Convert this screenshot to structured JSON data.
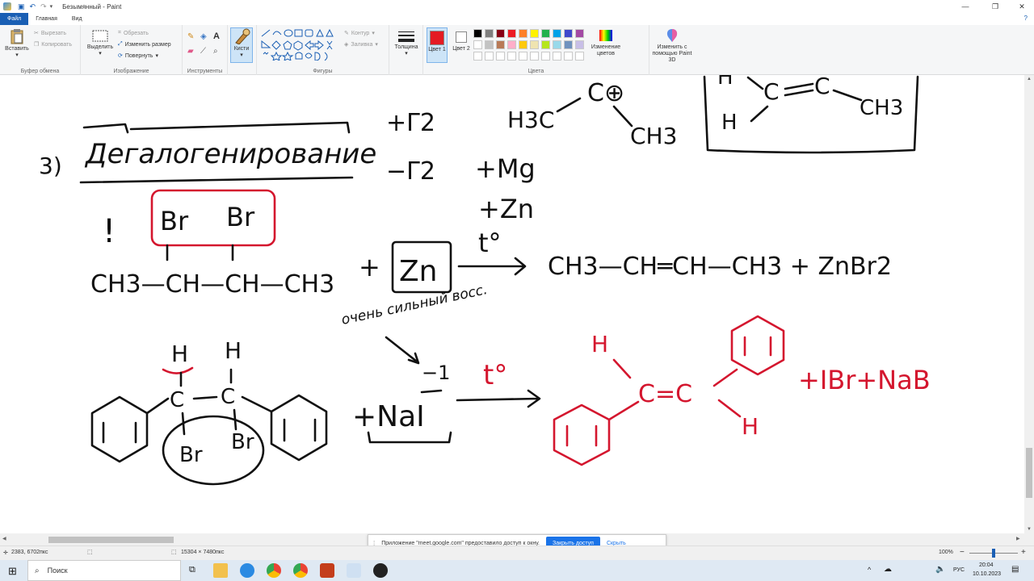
{
  "window": {
    "title": "Безымянный - Paint"
  },
  "tabs": [
    {
      "label": "Файл"
    },
    {
      "label": "Главная"
    },
    {
      "label": "Вид"
    }
  ],
  "ribbon": {
    "clipboard": {
      "label": "Буфер обмена",
      "paste": "Вставить",
      "cut": "Вырезать",
      "copy": "Копировать"
    },
    "image": {
      "label": "Изображение",
      "select": "Выделить",
      "crop": "Обрезать",
      "resize": "Изменить размер",
      "rotate": "Повернуть"
    },
    "tools": {
      "label": "Инструменты"
    },
    "brushes": {
      "label": "Кисти"
    },
    "shapes": {
      "label": "Фигуры",
      "outline": "Контур",
      "fill": "Заливка"
    },
    "size": {
      "label": "Толщина"
    },
    "colors": {
      "label": "Цвета",
      "color1": "Цвет 1",
      "color2": "Цвет 2",
      "edit": "Изменение цветов",
      "color1_value": "#e41b23",
      "palette": [
        "#000000",
        "#7f7f7f",
        "#880015",
        "#ed1c24",
        "#ff7f27",
        "#fff200",
        "#22b14c",
        "#00a2e8",
        "#3f48cc",
        "#a349a4",
        "#ffffff",
        "#c3c3c3",
        "#b97a57",
        "#ffaec9",
        "#ffc90e",
        "#efe4b0",
        "#b5e61d",
        "#99d9ea",
        "#7092be",
        "#c8bfe7"
      ]
    },
    "paint3d": {
      "label": "Изменить с помощью Paint 3D"
    }
  },
  "canvas": {
    "black_text": {
      "plus_g2": "+Γ2",
      "minus_g2": "−Γ2",
      "h3c": "H3C",
      "c_plus": "C⊕",
      "ch3_a": "CH3",
      "ch3_b": "CH3",
      "h_a": "H",
      "h_b": "H",
      "num": "3)",
      "heading": "Дегалогенирование",
      "plus_mg": "+Mg",
      "plus_zn": "+Zn",
      "excl": "!",
      "br1": "Br",
      "br2": "Br",
      "chain_left": "CH3—CH—CH—CH3",
      "plus": "+",
      "zn_box": "Zn",
      "temp": "t°",
      "product": "CH3—CH═CH—CH3 + ZnBr2",
      "note": "очень сильный восс.",
      "h1": "H",
      "h2": "H",
      "c1": "C",
      "c2": "C",
      "br3": "Br",
      "br4": "Br",
      "minus_one": "−1",
      "nai": "+NaI"
    },
    "red_text": {
      "temp": "t°",
      "h_top": "H",
      "cc": "C=C",
      "h_bottom": "H",
      "products": "+IBr+NaB"
    }
  },
  "notification": {
    "text": "Приложение \"meet.google.com\" предоставило доступ к окну.",
    "primary": "Закрыть доступ",
    "secondary": "Скрыть"
  },
  "status": {
    "cursor": "2383, 6702пкс",
    "size": "15304 × 7480пкс",
    "zoom": "100%"
  },
  "taskbar": {
    "search": "Поиск",
    "lang": "РУС",
    "time": "20:04",
    "date": "10.10.2023"
  }
}
